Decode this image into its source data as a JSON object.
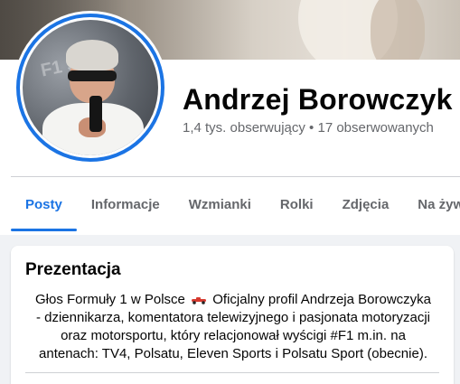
{
  "profile": {
    "name": "Andrzej Borowczyk",
    "followers": "1,4 tys. obserwujący • 17 obserwowanych"
  },
  "tabs": [
    {
      "label": "Posty",
      "active": true
    },
    {
      "label": "Informacje",
      "active": false
    },
    {
      "label": "Wzmianki",
      "active": false
    },
    {
      "label": "Rolki",
      "active": false
    },
    {
      "label": "Zdjęcia",
      "active": false
    },
    {
      "label": "Na żywo",
      "active": false
    }
  ],
  "intro": {
    "title": "Prezentacja",
    "bio_part1": "Głos Formuły 1 w Polsce",
    "bio_emoji": "race-car-icon",
    "bio_part2": "Oficjalny profil Andrzeja Borowczyka - dziennikarza, komentatora telewizyjnego i pasjonata motoryzacji oraz motorsportu, który relacjonował wyścigi #F1 m.in. na antenach: TV4, Polsatu, Eleven Sports i Polsatu Sport (obecnie)."
  },
  "colors": {
    "accent": "#1b74e4",
    "secondary_text": "#65676b",
    "background": "#f0f2f5"
  }
}
